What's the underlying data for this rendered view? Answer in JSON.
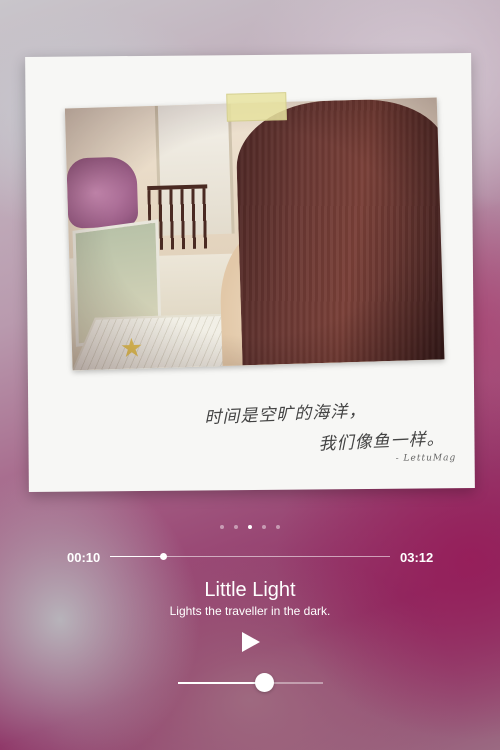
{
  "album_card": {
    "caption_line1": "时间是空旷的海洋，",
    "caption_line2": "我们像鱼一样。",
    "signature": "- LettuMag"
  },
  "pager": {
    "count": 5,
    "active_index": 2
  },
  "player": {
    "current_time": "00:10",
    "total_time": "03:12",
    "progress_fraction": 0.19,
    "volume_fraction": 0.59,
    "play_icon": "play-icon"
  },
  "track": {
    "title": "Little Light",
    "subtitle": "Lights the traveller in the dark."
  },
  "colors": {
    "accent": "#ffffff",
    "backdrop_primary": "#8d2f63"
  }
}
